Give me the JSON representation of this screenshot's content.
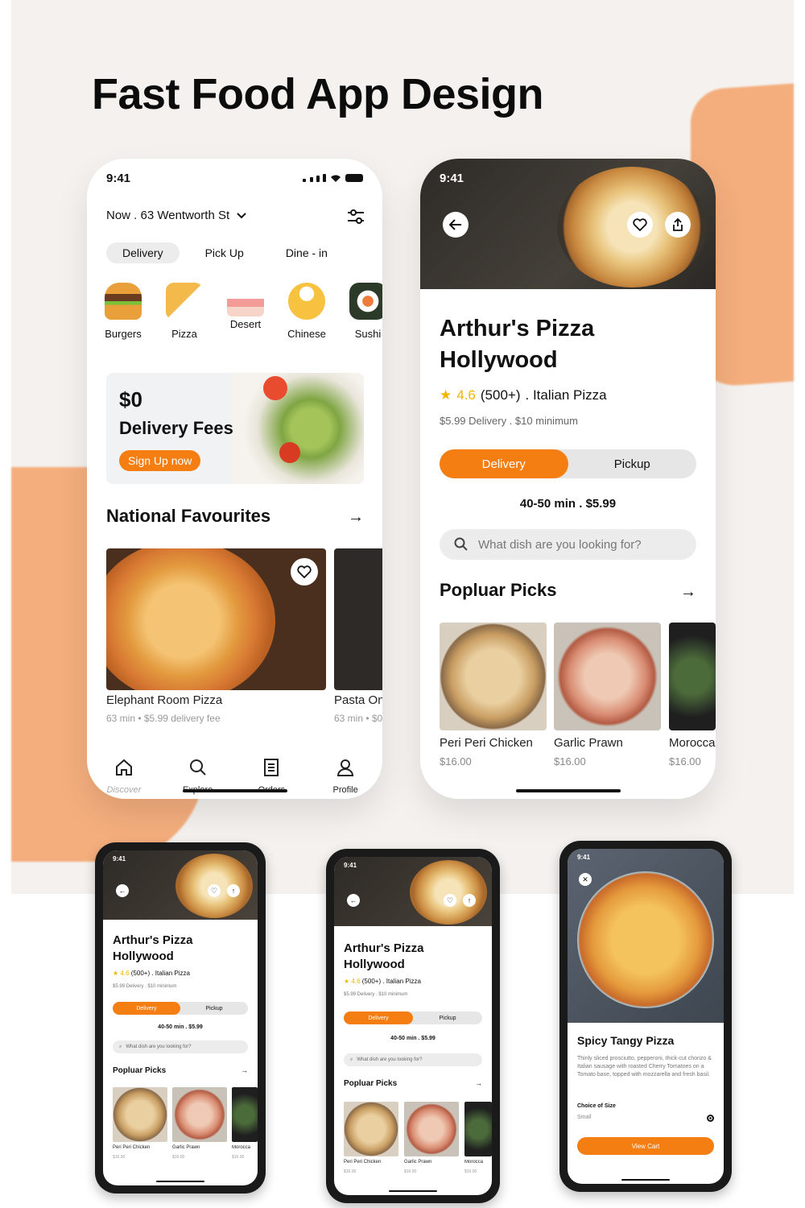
{
  "headline": "Fast Food App Design",
  "colors": {
    "accent": "#f57e13",
    "star": "#f5b400",
    "bg_panel": "#f4f1ee",
    "blob": "#f5a36a"
  },
  "home": {
    "time": "9:41",
    "location": "Now . 63 Wentworth St",
    "modes": [
      "Delivery",
      "Pick Up",
      "Dine - in"
    ],
    "active_mode": "Delivery",
    "categories": [
      "Burgers",
      "Pizza",
      "Desert",
      "Chinese",
      "Sushi"
    ],
    "promo": {
      "title": "$0",
      "subtitle": "Delivery Fees",
      "button": "Sign Up now"
    },
    "section_title": "National Favourites",
    "cards": [
      {
        "title": "Elephant Room Pizza",
        "subtitle": "63 min • $5.99 delivery fee"
      },
      {
        "title": "Pasta On",
        "subtitle": "63 min • $0"
      }
    ],
    "tabs": [
      {
        "label": "Discover",
        "icon": "home-icon"
      },
      {
        "label": "Explore",
        "icon": "search-icon"
      },
      {
        "label": "Orders",
        "icon": "receipt-icon"
      },
      {
        "label": "Profile",
        "icon": "user-icon"
      }
    ]
  },
  "detail": {
    "time": "9:41",
    "title": "Arthur's Pizza Hollywood",
    "rating": "4.6",
    "reviews": "(500+)",
    "cuisine": ".  Italian  Pizza",
    "meta": "$5.99 Delivery   .  $10 minimum",
    "seg": [
      "Delivery",
      "Pickup"
    ],
    "time_price": "40-50 min  .  $5.99",
    "search_placeholder": "What dish are you looking for?",
    "section_title": "Popluar Picks",
    "picks": [
      {
        "title": "Peri Peri Chicken",
        "price": "$16.00"
      },
      {
        "title": "Garlic Prawn",
        "price": "$16.00"
      },
      {
        "title": "Morocca",
        "price": "$16.00"
      }
    ]
  },
  "mini1": {
    "time": "9:41",
    "title": "Arthur's Pizza Hollywood",
    "rating": "4.6",
    "reviews": "(500+)",
    "cuisine": ".  Italian  Pizza",
    "meta": "$5.99 Delivery   .  $10 minimum",
    "seg": [
      "Delivery",
      "Pickup"
    ],
    "time_price": "40-50 min  .  $5.99",
    "search_placeholder": "What dish are you looking for?",
    "section_title": "Popluar Picks",
    "picks": [
      {
        "title": "Peri Peri Chicken",
        "price": "$16.00"
      },
      {
        "title": "Garlic Prawn",
        "price": "$16.00"
      },
      {
        "title": "Morocca",
        "price": "$16.00"
      }
    ]
  },
  "mini2": {
    "time": "9:41",
    "title": "Arthur's Pizza Hollywood",
    "rating": "4.6",
    "reviews": "(500+)",
    "cuisine": ".  Italian  Pizza",
    "meta": "$5.99 Delivery   .  $10 minimum",
    "seg": [
      "Delivery",
      "Pickup"
    ],
    "time_price": "40-50 min  .  $5.99",
    "search_placeholder": "What dish are you looking for?",
    "section_title": "Popluar Picks",
    "picks": [
      {
        "title": "Peri Peri Chicken",
        "price": "$16.00"
      },
      {
        "title": "Garlic Prawn",
        "price": "$16.00"
      },
      {
        "title": "Morocca",
        "price": "$16.00"
      }
    ]
  },
  "mini3": {
    "time": "9:41",
    "title": "Spicy Tangy Pizza",
    "description": "Thinly sliced prosciutto, pepperoni, thick-cut chorizo & Italian sausage with roasted Cherry Tomatoes on a Tomato base, topped with mozzarella and fresh basil.",
    "size_label": "Choice of Size",
    "size_value": "Small",
    "button": "View Cart"
  }
}
